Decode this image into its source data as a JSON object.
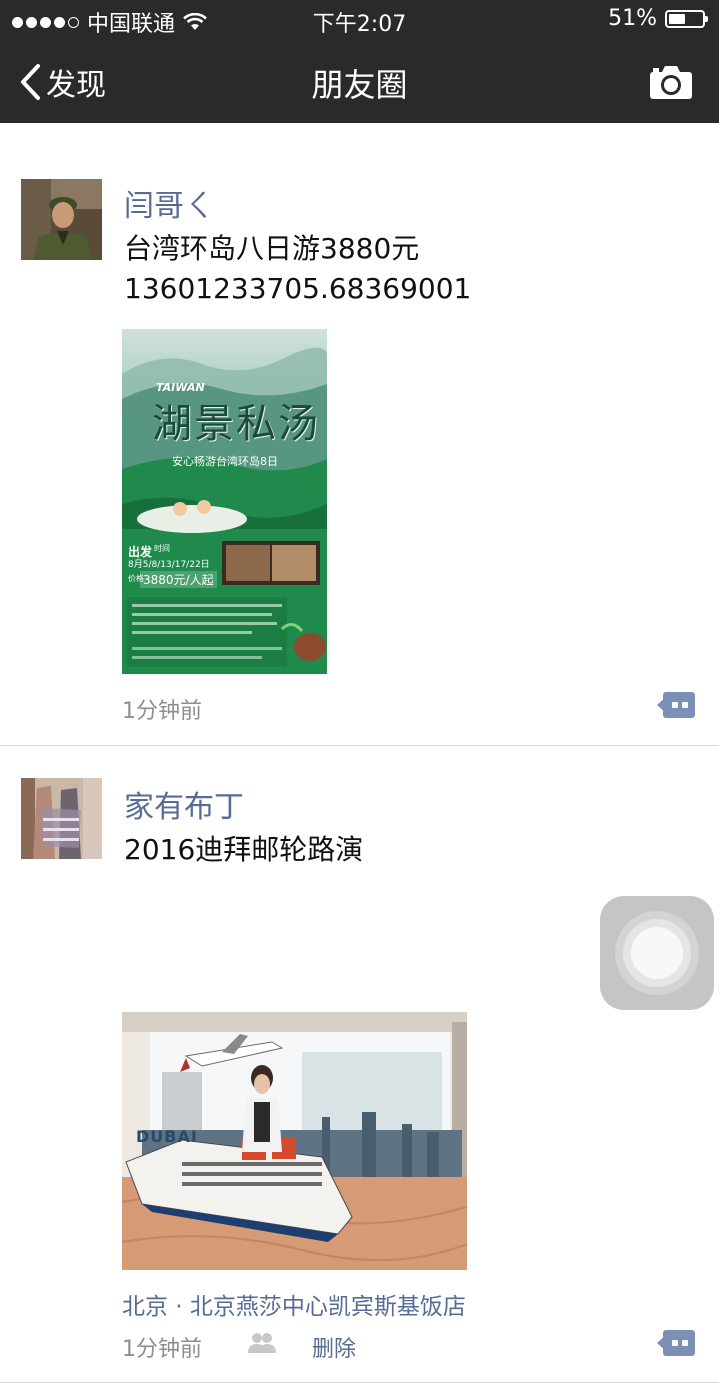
{
  "status_bar": {
    "carrier": "中国联通",
    "time": "下午2:07",
    "battery": "51%",
    "battery_level": 0.51
  },
  "nav": {
    "back_label": "发现",
    "title": "朋友圈",
    "camera_icon": "camera-icon"
  },
  "posts": [
    {
      "username": "闫哥ㄑ",
      "text_line1": "台湾环岛八日游3880元",
      "text_line2": "13601233705.68369001",
      "poster": {
        "tag": "TAIWAN",
        "title": "湖景私汤",
        "subtitle": "安心畅游台湾环岛8日",
        "departure_label": "出发",
        "time_label": "时间",
        "dates": "8月5/8/13/17/22日",
        "price_label": "价格",
        "price": "3880元/人起"
      },
      "time": "1分钟前"
    },
    {
      "username": "家有布丁",
      "text": "2016迪拜邮轮路演",
      "location": "北京 · 北京燕莎中心凯宾斯基饭店",
      "time": "1分钟前",
      "delete_label": "删除",
      "photo_sign": "DUBAI"
    }
  ],
  "colors": {
    "nav_bg": "#2a2a2c",
    "link": "#576b95",
    "meta": "#8e8e8e",
    "poster_green": "#1f8a4c"
  }
}
